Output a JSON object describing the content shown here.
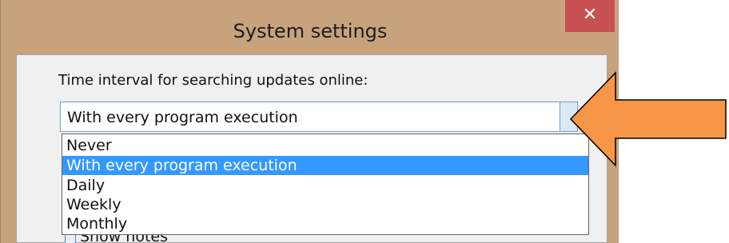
{
  "window": {
    "title": "System settings",
    "close_label": "✕"
  },
  "settings": {
    "interval_label": "Time interval for searching updates online:",
    "selected_value": "With every program execution",
    "options": [
      "Never",
      "With every program execution",
      "Daily",
      "Weekly",
      "Monthly"
    ],
    "selected_index": 1,
    "partially_hidden_text": "Show notes"
  },
  "annotation": {
    "arrow_color": "#f79646",
    "arrow_direction": "left",
    "arrow_icon": "left-arrow-icon"
  },
  "colors": {
    "window_frame": "#c7a27d",
    "close_button": "#c75050",
    "selection": "#3399ff"
  }
}
